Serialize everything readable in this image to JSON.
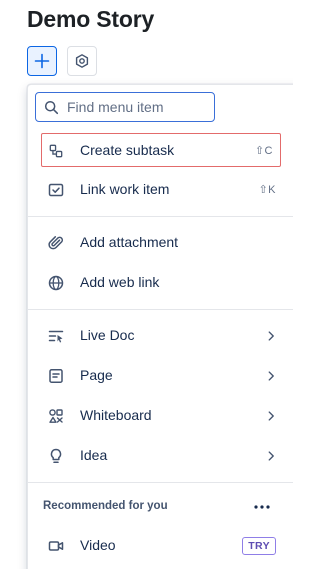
{
  "page": {
    "title": "Demo Story"
  },
  "toolbar": {
    "add_icon": "plus-icon",
    "settings_icon": "hexagon-gear-icon"
  },
  "menu": {
    "search": {
      "placeholder": "Find menu item",
      "value": ""
    },
    "items": [
      {
        "label": "Create subtask",
        "icon": "subtask-icon",
        "shortcut": "⇧C"
      },
      {
        "label": "Link work item",
        "icon": "link-checkbox-icon",
        "shortcut": "⇧K"
      },
      {
        "label": "Add attachment",
        "icon": "paperclip-icon"
      },
      {
        "label": "Add web link",
        "icon": "globe-icon"
      },
      {
        "label": "Live Doc",
        "icon": "live-doc-icon"
      },
      {
        "label": "Page",
        "icon": "page-icon"
      },
      {
        "label": "Whiteboard",
        "icon": "whiteboard-icon"
      },
      {
        "label": "Idea",
        "icon": "lightbulb-icon"
      }
    ],
    "recommended": {
      "title": "Recommended for you",
      "items": [
        {
          "label": "Video",
          "icon": "video-icon",
          "badge": "TRY"
        }
      ]
    }
  },
  "colors": {
    "accent": "#0c66e4",
    "highlight_border": "#e36b6b",
    "try_badge": "#5e4db2"
  }
}
